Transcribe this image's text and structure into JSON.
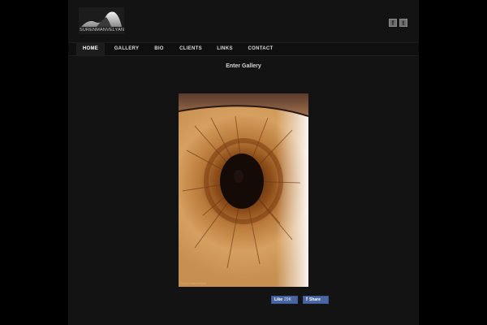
{
  "header": {
    "logo_text": "SURENMANVELYAN",
    "social": {
      "facebook_glyph": "f",
      "twitter_glyph": "t"
    }
  },
  "nav": {
    "items": [
      {
        "label": "HOME",
        "active": true
      },
      {
        "label": "GALLERY",
        "active": false
      },
      {
        "label": "BIO",
        "active": false
      },
      {
        "label": "CLIENTS",
        "active": false
      },
      {
        "label": "LINKS",
        "active": false
      },
      {
        "label": "CONTACT",
        "active": false
      }
    ]
  },
  "main": {
    "enter_gallery": "Enter Gallery",
    "photo_watermark": "Suren Manvelyan"
  },
  "facebook": {
    "like_label": "Like",
    "like_count": "29K",
    "share_label": "Share"
  },
  "colors": {
    "background": "#000000",
    "page": "#131313",
    "facebook_blue": "#4a66a0"
  }
}
